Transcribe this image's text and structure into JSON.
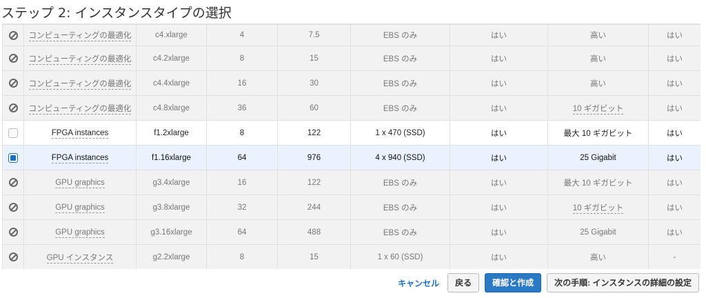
{
  "page": {
    "title": "ステップ 2: インスタンスタイプの選択"
  },
  "table": {
    "rows": [
      {
        "state": "disabled",
        "family": "コンピューティングの最適化",
        "family_dashed": true,
        "type": "c4.xlarge",
        "vcpu": "4",
        "memory": "7.5",
        "storage": "EBS のみ",
        "ebs_opt": "はい",
        "network": "高い",
        "network_dashed": false,
        "ipv6": "はい"
      },
      {
        "state": "disabled",
        "family": "コンピューティングの最適化",
        "family_dashed": true,
        "type": "c4.2xlarge",
        "vcpu": "8",
        "memory": "15",
        "storage": "EBS のみ",
        "ebs_opt": "はい",
        "network": "高い",
        "network_dashed": false,
        "ipv6": "はい"
      },
      {
        "state": "disabled",
        "family": "コンピューティングの最適化",
        "family_dashed": true,
        "type": "c4.4xlarge",
        "vcpu": "16",
        "memory": "30",
        "storage": "EBS のみ",
        "ebs_opt": "はい",
        "network": "高い",
        "network_dashed": false,
        "ipv6": "はい"
      },
      {
        "state": "disabled",
        "family": "コンピューティングの最適化",
        "family_dashed": true,
        "type": "c4.8xlarge",
        "vcpu": "36",
        "memory": "60",
        "storage": "EBS のみ",
        "ebs_opt": "はい",
        "network": "10 ギガビット",
        "network_dashed": true,
        "ipv6": "はい"
      },
      {
        "state": "enabled",
        "family": "FPGA instances",
        "family_dashed": true,
        "type": "f1.2xlarge",
        "vcpu": "8",
        "memory": "122",
        "storage": "1 x 470 (SSD)",
        "ebs_opt": "はい",
        "network": "最大 10 ギガビット",
        "network_dashed": false,
        "ipv6": "はい"
      },
      {
        "state": "selected",
        "family": "FPGA instances",
        "family_dashed": true,
        "type": "f1.16xlarge",
        "vcpu": "64",
        "memory": "976",
        "storage": "4 x 940 (SSD)",
        "ebs_opt": "はい",
        "network": "25 Gigabit",
        "network_dashed": false,
        "ipv6": "はい"
      },
      {
        "state": "disabled",
        "family": "GPU graphics",
        "family_dashed": true,
        "type": "g3.4xlarge",
        "vcpu": "16",
        "memory": "122",
        "storage": "EBS のみ",
        "ebs_opt": "はい",
        "network": "最大 10 ギガビット",
        "network_dashed": false,
        "ipv6": "はい"
      },
      {
        "state": "disabled",
        "family": "GPU graphics",
        "family_dashed": true,
        "type": "g3.8xlarge",
        "vcpu": "32",
        "memory": "244",
        "storage": "EBS のみ",
        "ebs_opt": "はい",
        "network": "10 ギガビット",
        "network_dashed": true,
        "ipv6": "はい"
      },
      {
        "state": "disabled",
        "family": "GPU graphics",
        "family_dashed": true,
        "type": "g3.16xlarge",
        "vcpu": "64",
        "memory": "488",
        "storage": "EBS のみ",
        "ebs_opt": "はい",
        "network": "25 Gigabit",
        "network_dashed": false,
        "ipv6": "はい"
      },
      {
        "state": "disabled",
        "family": "GPU インスタンス",
        "family_dashed": true,
        "type": "g2.2xlarge",
        "vcpu": "8",
        "memory": "15",
        "storage": "1 x 60 (SSD)",
        "ebs_opt": "はい",
        "network": "高い",
        "network_dashed": false,
        "ipv6": "-"
      }
    ]
  },
  "footer": {
    "cancel_label": "キャンセル",
    "back_label": "戻る",
    "review_launch_label": "確認と作成",
    "next_label": "次の手順: インスタンスの詳細の設定"
  },
  "colors": {
    "accent": "#2b78c5",
    "link": "#1b6ec2",
    "selected_row_bg": "#e9f2fd",
    "disabled_row_bg": "#f2f2f2"
  }
}
